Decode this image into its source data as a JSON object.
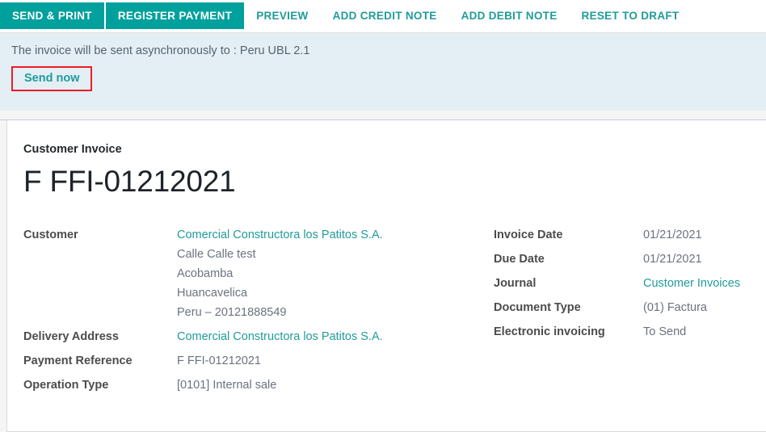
{
  "toolbar": {
    "primary_buttons": [
      {
        "label": "SEND & PRINT"
      },
      {
        "label": "REGISTER PAYMENT"
      }
    ],
    "link_buttons": [
      {
        "label": "PREVIEW"
      },
      {
        "label": "ADD CREDIT NOTE"
      },
      {
        "label": "ADD DEBIT NOTE"
      },
      {
        "label": "RESET TO DRAFT"
      }
    ]
  },
  "alert": {
    "message": "The invoice will be sent asynchronously to : Peru UBL 2.1",
    "action_label": "Send now",
    "background_color": "#e4eff5",
    "highlight_color": "#ee1c25"
  },
  "invoice": {
    "subtitle": "Customer Invoice",
    "number": "F FFI-01212021",
    "left_fields": [
      {
        "label": "Customer",
        "value_lines": [
          {
            "text": "Comercial Constructora los Patitos S.A.",
            "link": true
          },
          {
            "text": "Calle Calle test",
            "link": false
          },
          {
            "text": "Acobamba",
            "link": false
          },
          {
            "text": "Huancavelica",
            "link": false
          },
          {
            "text": "Peru – 20121888549",
            "link": false
          }
        ]
      },
      {
        "label": "Delivery Address",
        "value_lines": [
          {
            "text": "Comercial Constructora los Patitos S.A.",
            "link": true
          }
        ]
      },
      {
        "label": "Payment Reference",
        "value_lines": [
          {
            "text": "F FFI-01212021",
            "link": false
          }
        ]
      },
      {
        "label": "Operation Type",
        "value_lines": [
          {
            "text": "[0101] Internal sale",
            "link": false
          }
        ]
      }
    ],
    "right_fields": [
      {
        "label": "Invoice Date",
        "value": "01/21/2021",
        "link": false
      },
      {
        "label": "Due Date",
        "value": "01/21/2021",
        "link": false
      },
      {
        "label": "Journal",
        "value": "Customer Invoices",
        "link": true
      },
      {
        "label": "Document Type",
        "value": "(01) Factura",
        "link": false
      },
      {
        "label": "Electronic invoicing",
        "value": "To Send",
        "link": false
      }
    ]
  },
  "theme": {
    "accent": "#00a09d",
    "link": "#1f9c99",
    "page_background": "#f5f5f5"
  }
}
